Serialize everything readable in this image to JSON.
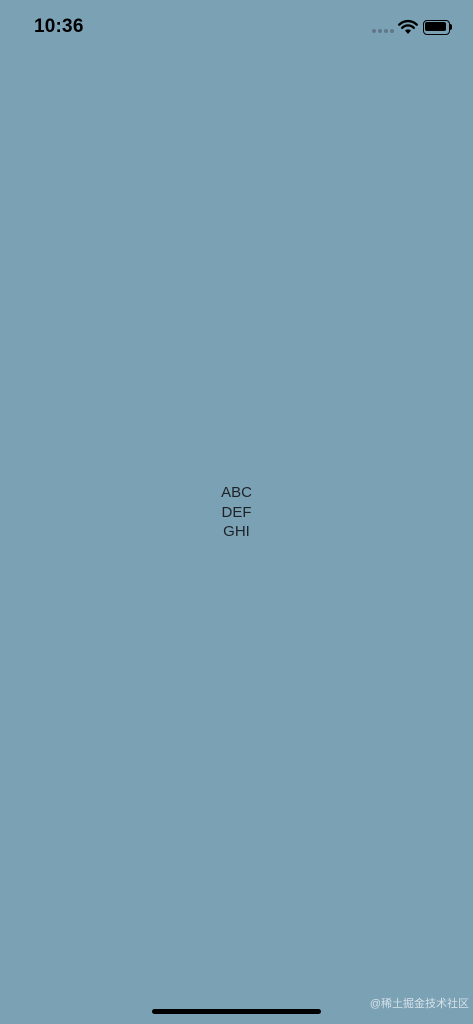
{
  "status_bar": {
    "time": "10:36",
    "signal_icon": "cellular-signal-dots",
    "wifi_icon": "wifi",
    "battery_icon": "battery-full"
  },
  "content": {
    "lines": [
      "ABC",
      "DEF",
      "GHI"
    ]
  },
  "watermark": "@稀土掘金技术社区",
  "colors": {
    "background": "#7ba1b5",
    "text": "#1e2328",
    "status_foreground": "#000000"
  }
}
